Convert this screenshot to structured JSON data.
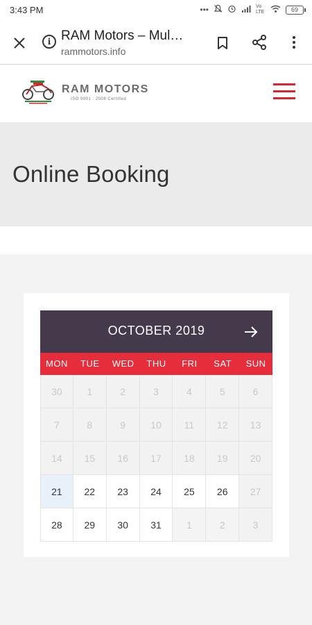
{
  "status_bar": {
    "time": "3:43 PM",
    "network": "Vo LTE",
    "battery": "69"
  },
  "browser": {
    "page_title": "RAM Motors – Mul…",
    "url": "rammotors.info"
  },
  "site": {
    "brand_name": "RAM MOTORS",
    "brand_tagline": "ISO 9001 : 2008 Certified",
    "accent_color": "#e0242f"
  },
  "page": {
    "title": "Online Booking"
  },
  "calendar": {
    "month_label": "OCTOBER 2019",
    "header_color": "#453a4b",
    "weekday_bar_color": "#e52d3b",
    "weekdays": [
      "MON",
      "TUE",
      "WED",
      "THU",
      "FRI",
      "SAT",
      "SUN"
    ],
    "weeks": [
      [
        {
          "day": "30",
          "state": "past"
        },
        {
          "day": "1",
          "state": "past"
        },
        {
          "day": "2",
          "state": "past"
        },
        {
          "day": "3",
          "state": "past"
        },
        {
          "day": "4",
          "state": "past"
        },
        {
          "day": "5",
          "state": "past"
        },
        {
          "day": "6",
          "state": "past"
        }
      ],
      [
        {
          "day": "7",
          "state": "past"
        },
        {
          "day": "8",
          "state": "past"
        },
        {
          "day": "9",
          "state": "past"
        },
        {
          "day": "10",
          "state": "past"
        },
        {
          "day": "11",
          "state": "past"
        },
        {
          "day": "12",
          "state": "past"
        },
        {
          "day": "13",
          "state": "past"
        }
      ],
      [
        {
          "day": "14",
          "state": "past"
        },
        {
          "day": "15",
          "state": "past"
        },
        {
          "day": "16",
          "state": "past"
        },
        {
          "day": "17",
          "state": "past"
        },
        {
          "day": "18",
          "state": "past"
        },
        {
          "day": "19",
          "state": "past"
        },
        {
          "day": "20",
          "state": "past"
        }
      ],
      [
        {
          "day": "21",
          "state": "today"
        },
        {
          "day": "22",
          "state": "active"
        },
        {
          "day": "23",
          "state": "active"
        },
        {
          "day": "24",
          "state": "active"
        },
        {
          "day": "25",
          "state": "active"
        },
        {
          "day": "26",
          "state": "active"
        },
        {
          "day": "27",
          "state": "past"
        }
      ],
      [
        {
          "day": "28",
          "state": "active"
        },
        {
          "day": "29",
          "state": "active"
        },
        {
          "day": "30",
          "state": "active"
        },
        {
          "day": "31",
          "state": "active"
        },
        {
          "day": "1",
          "state": "next-month"
        },
        {
          "day": "2",
          "state": "next-month"
        },
        {
          "day": "3",
          "state": "past"
        }
      ]
    ]
  }
}
